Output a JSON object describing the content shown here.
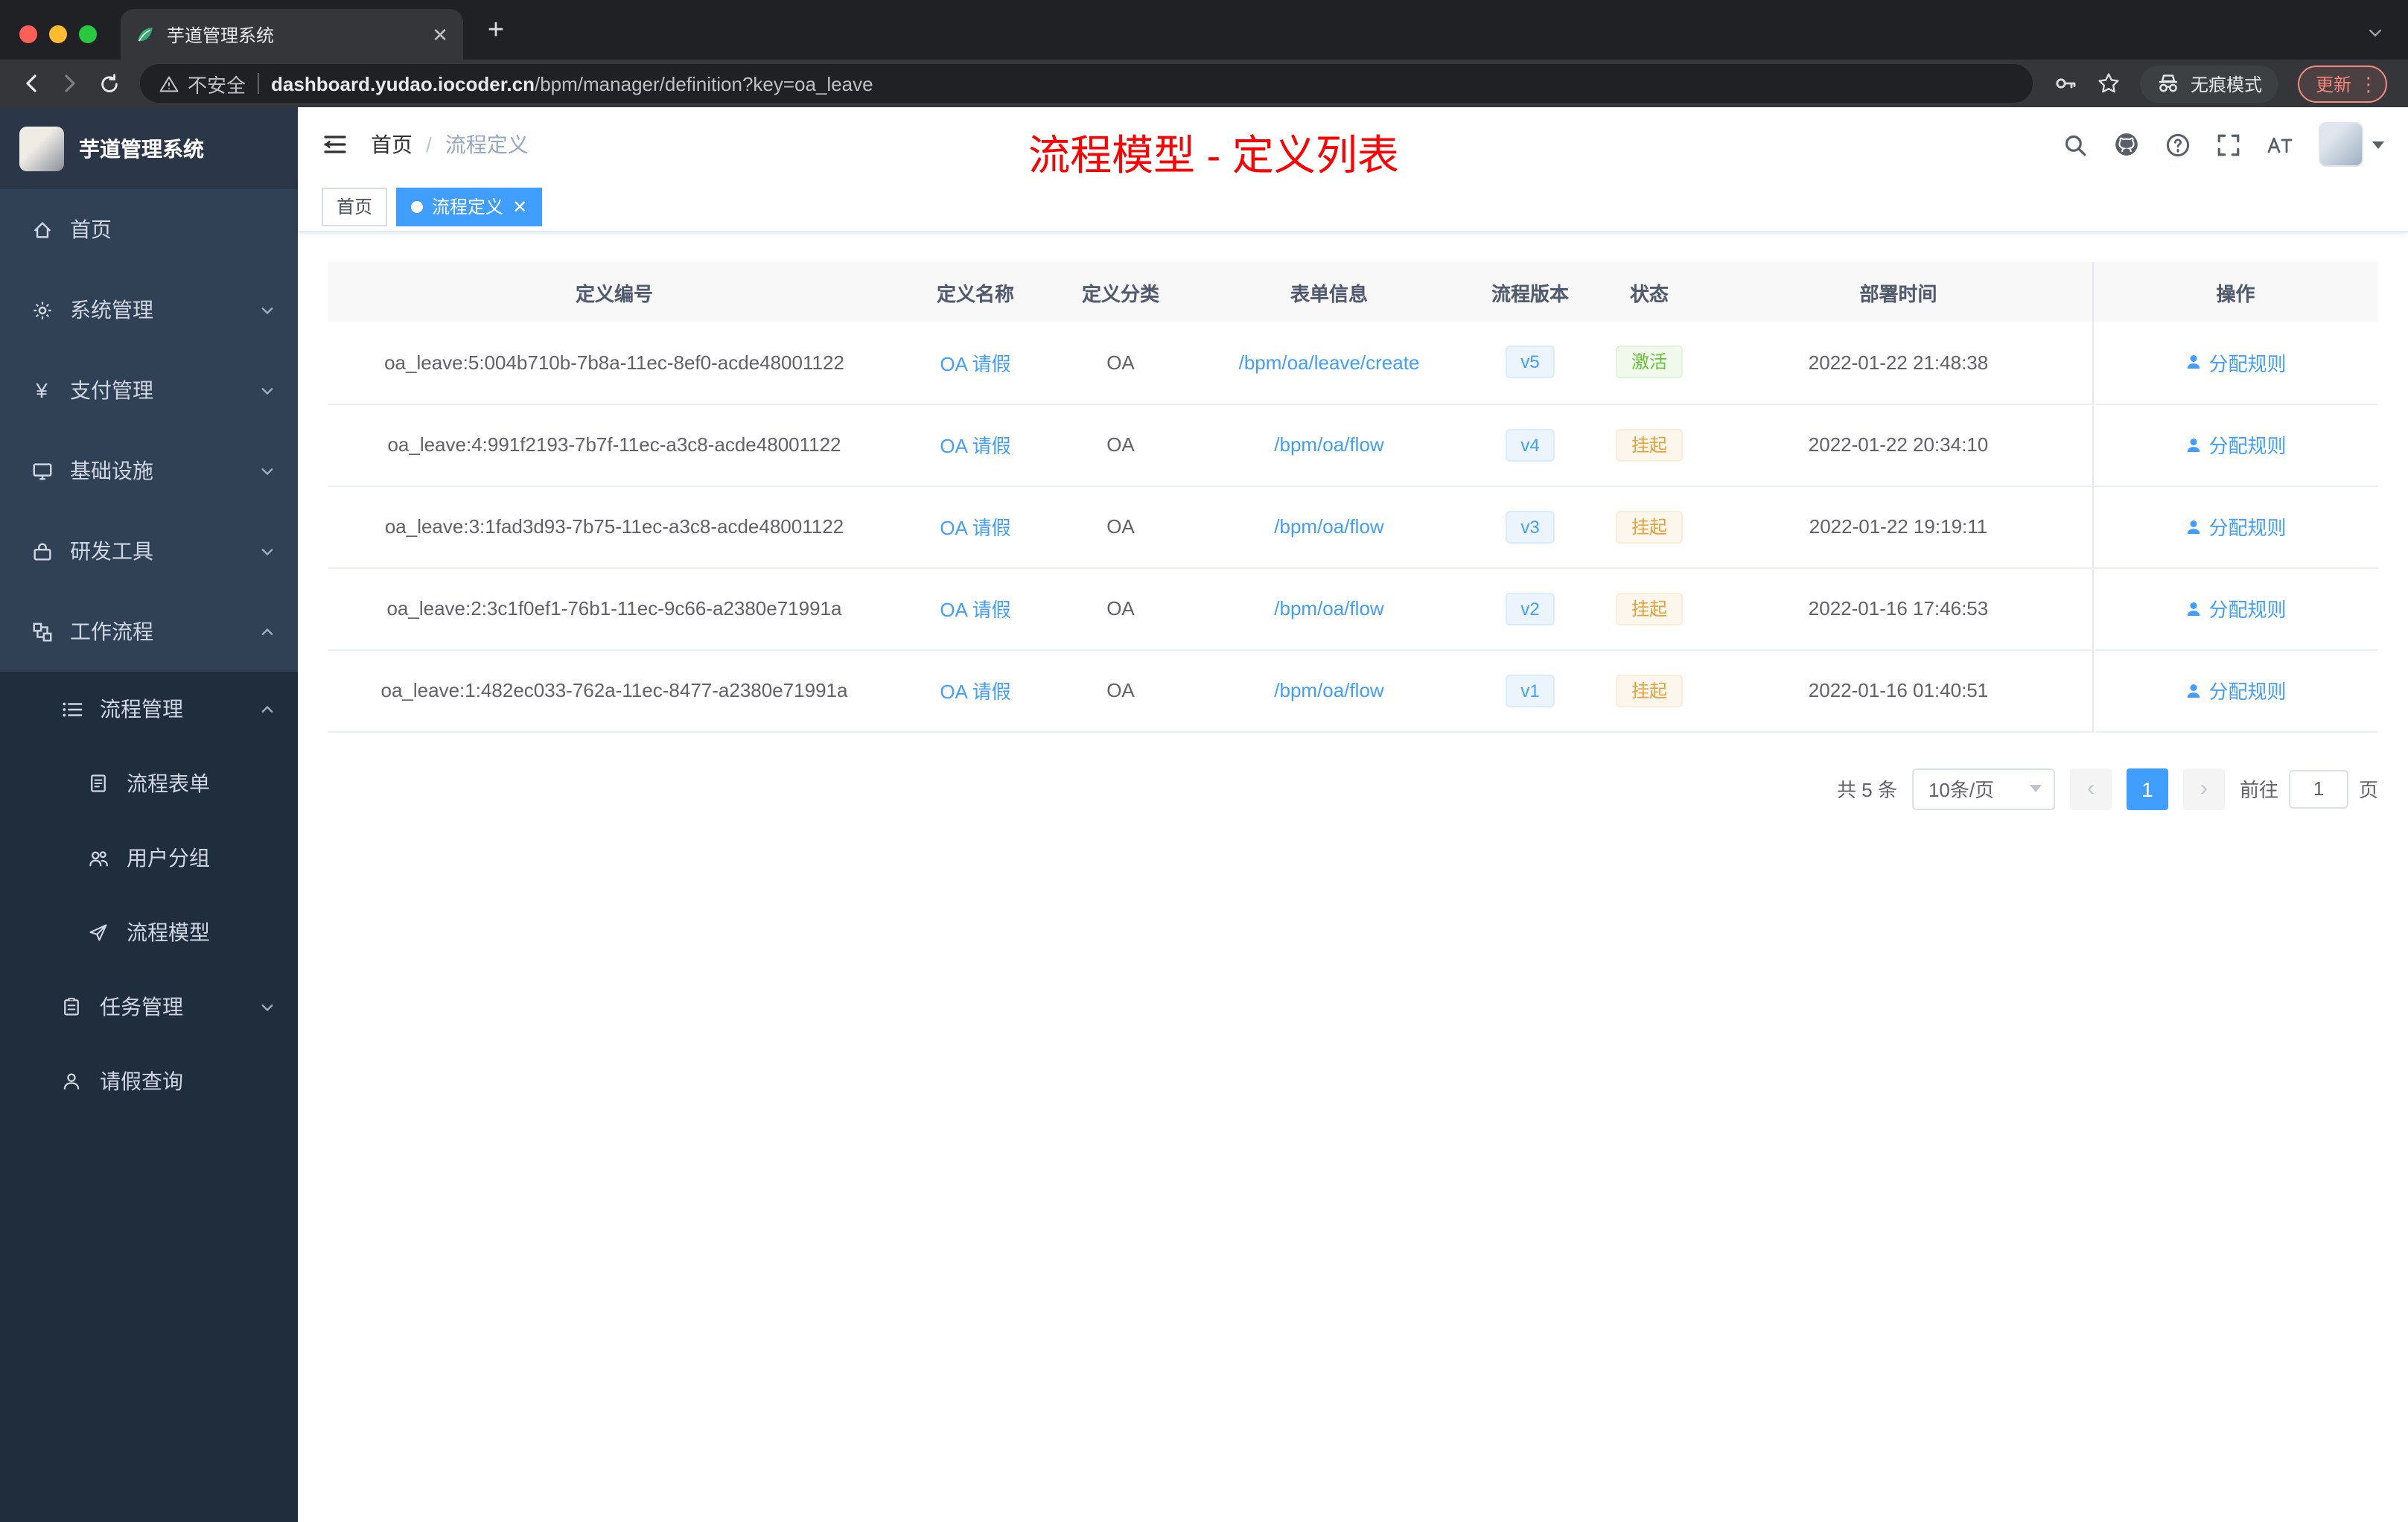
{
  "browser": {
    "tab_title": "芋道管理系统",
    "security_label": "不安全",
    "url_domain": "dashboard.yudao.iocoder.cn",
    "url_path": "/bpm/manager/definition?key=oa_leave",
    "incognito_label": "无痕模式",
    "update_label": "更新"
  },
  "sidebar": {
    "logo_title": "芋道管理系统",
    "items": [
      {
        "label": "首页"
      },
      {
        "label": "系统管理"
      },
      {
        "label": "支付管理"
      },
      {
        "label": "基础设施"
      },
      {
        "label": "研发工具"
      },
      {
        "label": "工作流程"
      },
      {
        "label": "流程管理"
      },
      {
        "label": "流程表单"
      },
      {
        "label": "用户分组"
      },
      {
        "label": "流程模型"
      },
      {
        "label": "任务管理"
      },
      {
        "label": "请假查询"
      }
    ]
  },
  "header": {
    "breadcrumb_home": "首页",
    "breadcrumb_current": "流程定义",
    "annotation": "流程模型 - 定义列表"
  },
  "tags": {
    "home": "首页",
    "active": "流程定义"
  },
  "table": {
    "columns": [
      "定义编号",
      "定义名称",
      "定义分类",
      "表单信息",
      "流程版本",
      "状态",
      "部署时间",
      "操作"
    ],
    "rows": [
      {
        "id": "oa_leave:5:004b710b-7b8a-11ec-8ef0-acde48001122",
        "name": "OA 请假",
        "category": "OA",
        "form": "/bpm/oa/leave/create",
        "version": "v5",
        "status": "激活",
        "time": "2022-01-22 21:48:38",
        "action": "分配规则"
      },
      {
        "id": "oa_leave:4:991f2193-7b7f-11ec-a3c8-acde48001122",
        "name": "OA 请假",
        "category": "OA",
        "form": "/bpm/oa/flow",
        "version": "v4",
        "status": "挂起",
        "time": "2022-01-22 20:34:10",
        "action": "分配规则"
      },
      {
        "id": "oa_leave:3:1fad3d93-7b75-11ec-a3c8-acde48001122",
        "name": "OA 请假",
        "category": "OA",
        "form": "/bpm/oa/flow",
        "version": "v3",
        "status": "挂起",
        "time": "2022-01-22 19:19:11",
        "action": "分配规则"
      },
      {
        "id": "oa_leave:2:3c1f0ef1-76b1-11ec-9c66-a2380e71991a",
        "name": "OA 请假",
        "category": "OA",
        "form": "/bpm/oa/flow",
        "version": "v2",
        "status": "挂起",
        "time": "2022-01-16 17:46:53",
        "action": "分配规则"
      },
      {
        "id": "oa_leave:1:482ec033-762a-11ec-8477-a2380e71991a",
        "name": "OA 请假",
        "category": "OA",
        "form": "/bpm/oa/flow",
        "version": "v1",
        "status": "挂起",
        "time": "2022-01-16 01:40:51",
        "action": "分配规则"
      }
    ]
  },
  "pagination": {
    "total": "共 5 条",
    "page_size": "10条/页",
    "page": "1",
    "goto_label": "前往",
    "page_unit": "页",
    "goto_value": "1"
  },
  "colors": {
    "accent": "#409eff",
    "success": "#67c23a",
    "warning": "#e6a23c",
    "annotation": "#fe0000",
    "sidebar_bg": "#304156",
    "submenu_bg": "#1f2d3d"
  }
}
